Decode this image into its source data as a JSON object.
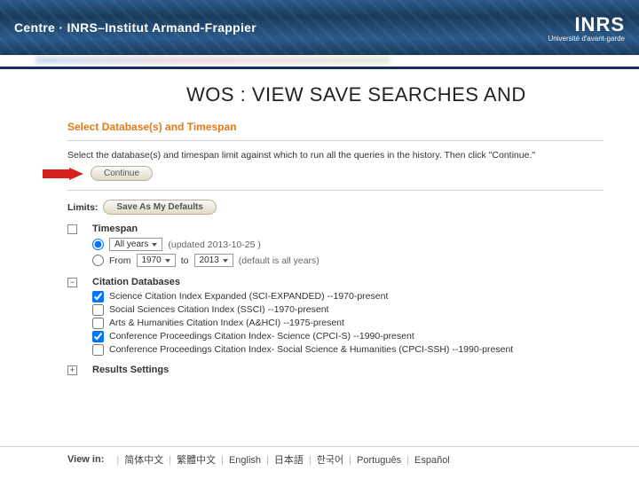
{
  "banner": {
    "org_title": "Centre · INRS–Institut Armand-Frappier",
    "logo_main": "INRS",
    "logo_sub": "Université d'avant-garde"
  },
  "slide": {
    "title": "WOS : VIEW SAVE SEARCHES AND"
  },
  "wos": {
    "section_title": "Select Database(s) and Timespan",
    "instruction": "Select the database(s) and timespan limit against which to run all the queries in the history. Then click \"Continue.\"",
    "continue_label": "Continue",
    "limits_label": "Limits:",
    "save_defaults_label": "Save As My Defaults",
    "timespan": {
      "title": "Timespan",
      "all_years_label": "All years",
      "all_years_note": "(updated 2013-10-25 )",
      "from_label": "From",
      "from_value": "1970",
      "to_label": "to",
      "to_value": "2013",
      "from_to_note": "(default is all years)",
      "tree_state": ""
    },
    "citation": {
      "title": "Citation Databases",
      "tree_state": "−",
      "items": [
        {
          "label": "Science Citation Index Expanded (SCI-EXPANDED) --1970-present",
          "checked": true
        },
        {
          "label": "Social Sciences Citation Index (SSCI) --1970-present",
          "checked": false
        },
        {
          "label": "Arts & Humanities Citation Index (A&HCI) --1975-present",
          "checked": false
        },
        {
          "label": "Conference Proceedings Citation Index- Science (CPCI-S) --1990-present",
          "checked": true
        },
        {
          "label": "Conference Proceedings Citation Index- Social Science & Humanities (CPCI-SSH) --1990-present",
          "checked": false
        }
      ]
    },
    "results_title": "Results Settings",
    "results_tree_state": "+"
  },
  "langbar": {
    "label": "View in:",
    "items": [
      "简体中文",
      "繁體中文",
      "English",
      "日本語",
      "한국어",
      "Português",
      "Español"
    ]
  }
}
